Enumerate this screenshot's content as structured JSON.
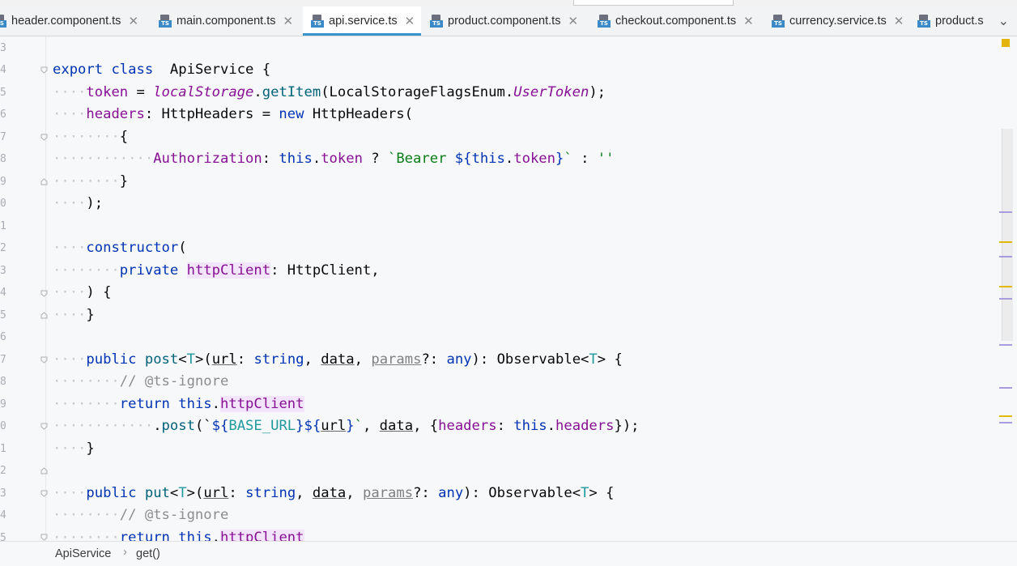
{
  "tabs": [
    {
      "label": "header.component.ts",
      "active": false
    },
    {
      "label": "main.component.ts",
      "active": false
    },
    {
      "label": "api.service.ts",
      "active": true
    },
    {
      "label": "product.component.ts",
      "active": false
    },
    {
      "label": "checkout.component.ts",
      "active": false
    },
    {
      "label": "currency.service.ts",
      "active": false
    },
    {
      "label": "product.s",
      "active": false
    }
  ],
  "tab_close_glyph": "✕",
  "ts_badge": "TS",
  "more_tabs_glyph": "⌄",
  "line_numbers": [
    "3",
    "4",
    "5",
    "6",
    "7",
    "8",
    "9",
    "0",
    "1",
    "2",
    "3",
    "4",
    "5",
    "6",
    "7",
    "8",
    "9",
    "0",
    "1",
    "2",
    "3",
    "4",
    "5"
  ],
  "code": {
    "l4": {
      "k1": "export",
      "k2": "class",
      "name": "ApiService",
      "rest": " {"
    },
    "l5": {
      "field": "token",
      "eq": " = ",
      "ls": "localStorage",
      "dot": ".",
      "fn": "getItem",
      "p1": "(LocalStorageFlagsEnum.",
      "en": "UserToken",
      "p2": ");"
    },
    "l6": {
      "field": "headers",
      "c1": ": HttpHeaders = ",
      "kw": "new",
      "rest": " HttpHeaders("
    },
    "l7": {
      "t": "{"
    },
    "l8": {
      "field": "Authorization",
      "c1": ": ",
      "kw1": "this",
      "d1": ".",
      "fld": "token",
      "q": " ? ",
      "s1": "`Bearer ",
      "tpl1": "${",
      "kw2": "this",
      "d2": ".",
      "fld2": "token",
      "tpl2": "}",
      "s2": "`",
      "c2": " : ",
      "s3": "''"
    },
    "l9": {
      "t": "}"
    },
    "l10": {
      "t": ");"
    },
    "l12": {
      "kw": "constructor",
      "t": "("
    },
    "l13": {
      "kw": "private",
      "field": "httpClient",
      "rest": ": HttpClient,"
    },
    "l14": {
      "t": ") {"
    },
    "l15": {
      "t": "}"
    },
    "l17": {
      "kw": "public",
      "fn": "post",
      "lt": "<",
      "tp": "T",
      "gt": ">(",
      "a1": "url",
      "c1": ": ",
      "k1": "string",
      "c2": ", ",
      "a2": "data",
      "c3": ", ",
      "a3": "params",
      "c4": "?: ",
      "k2": "any",
      "c5": "): Observable<",
      "tp2": "T",
      "c6": "> {"
    },
    "l18": {
      "t": "// @ts-ignore"
    },
    "l19": {
      "kw": "return",
      "sp": " ",
      "kw2": "this",
      "d": ".",
      "field": "httpClient"
    },
    "l20": {
      "d": ".",
      "fn": "post",
      "p": "(`",
      "tpl1": "${",
      "cst": "BASE_URL",
      "tpl2": "}${",
      "a1": "url",
      "tpl3": "}",
      "s": "`",
      "c1": ", ",
      "a2": "data",
      "c2": ", {",
      "field": "headers",
      "c3": ": ",
      "kw": "this",
      "d2": ".",
      "fld": "headers",
      "c4": "});"
    },
    "l21": {
      "t": "}"
    },
    "l23": {
      "kw": "public",
      "fn": "put",
      "lt": "<",
      "tp": "T",
      "gt": ">(",
      "a1": "url",
      "c1": ": ",
      "k1": "string",
      "c2": ", ",
      "a2": "data",
      "c3": ", ",
      "a3": "params",
      "c4": "?: ",
      "k2": "any",
      "c5": "): Observable<",
      "tp2": "T",
      "c6": "> {"
    },
    "l24": {
      "t": "// @ts-ignore"
    },
    "l25": {
      "kw": "return",
      "sp": " ",
      "kw2": "this",
      "d": ".",
      "field": "httpClient"
    }
  },
  "breadcrumb": {
    "class": "ApiService",
    "sep": "›",
    "method": "get()"
  },
  "colors": {
    "active_tab_underline": "#3a94cc",
    "keyword": "#0033b3",
    "field": "#871094",
    "string": "#067d17",
    "comment": "#8c8c8c",
    "warning_marker": "#e2b800"
  }
}
